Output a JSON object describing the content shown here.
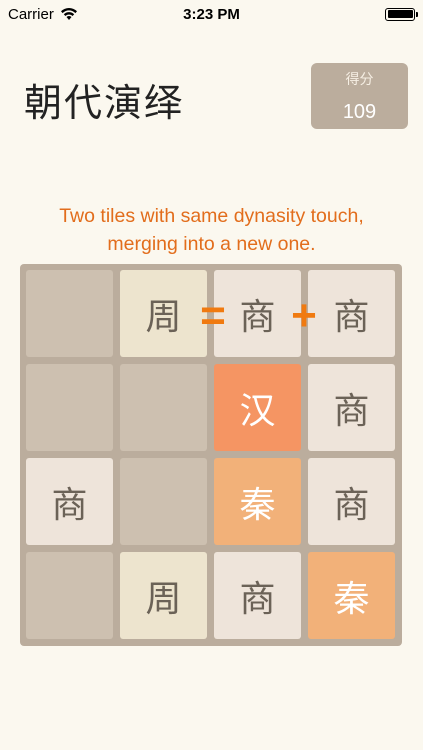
{
  "status": {
    "carrier": "Carrier",
    "time": "3:23 PM"
  },
  "header": {
    "title": "朝代演绎",
    "score_label": "得分",
    "score_value": "109"
  },
  "hint": {
    "line1": "Two tiles with same dynasity touch,",
    "line2": "merging into a new one."
  },
  "board": {
    "rows": [
      [
        "",
        "周",
        "商",
        "商"
      ],
      [
        "",
        "",
        "汉",
        "商"
      ],
      [
        "商",
        "",
        "秦",
        "商"
      ],
      [
        "",
        "周",
        "商",
        "秦"
      ]
    ],
    "operators": {
      "equals": "=",
      "plus": "+"
    }
  },
  "colors": {
    "background": "#fbf8ef",
    "board": "#bbad9d",
    "empty_tile": "#cdc0b0",
    "zhou_tile": "#ede4ce",
    "shang_tile": "#eee4da",
    "qin_tile": "#f2b179",
    "han_tile": "#f59563",
    "accent": "#e26d1c"
  }
}
